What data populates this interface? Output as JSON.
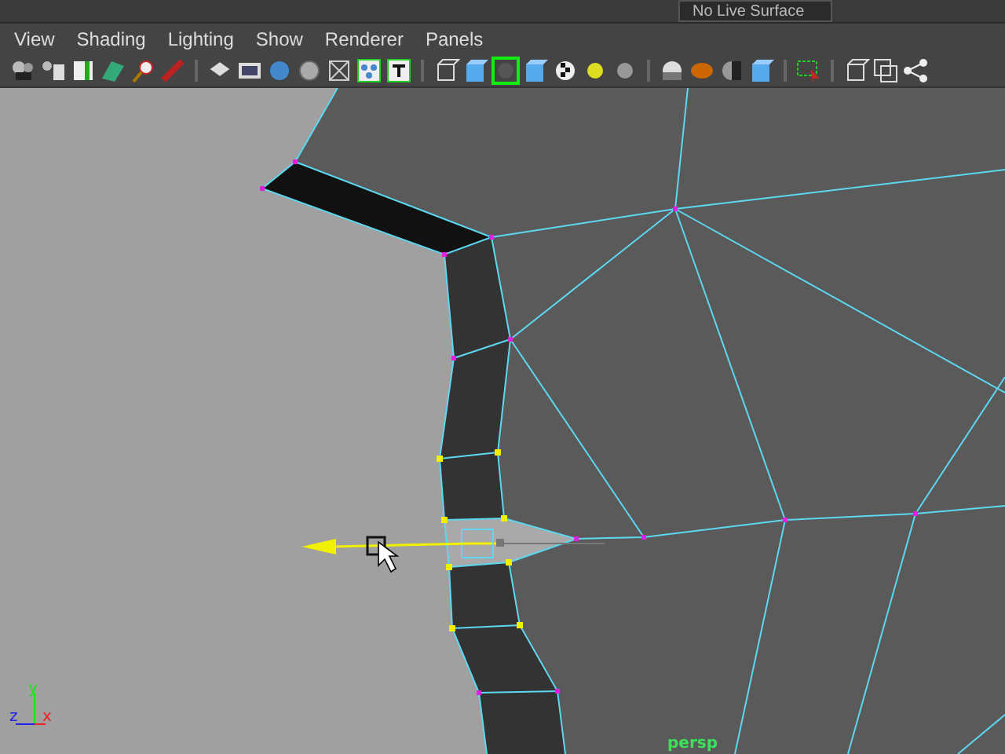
{
  "shelf": {
    "live_surface_field": "No Live Surface"
  },
  "menu": [
    "View",
    "Shading",
    "Lighting",
    "Show",
    "Renderer",
    "Panels"
  ],
  "viewport": {
    "camera_label": "persp",
    "axis_labels": [
      "y",
      "z",
      "x"
    ]
  }
}
